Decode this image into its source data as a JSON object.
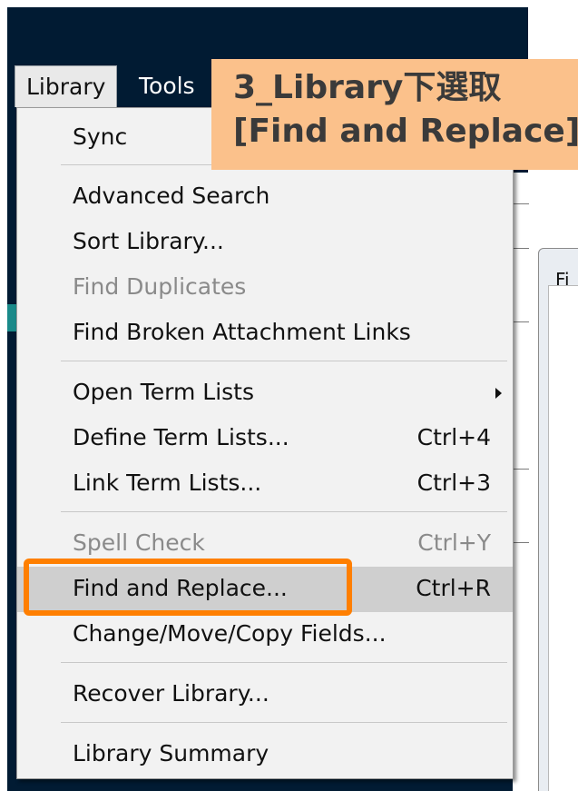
{
  "menubar": {
    "library": "Library",
    "tools": "Tools"
  },
  "annotation": {
    "line1": "3_Library下選取",
    "line2": "[Find and Replace]"
  },
  "background_window": {
    "title_fragment": "Fi"
  },
  "menu": {
    "items": [
      {
        "label": "Sync",
        "shortcut": ""
      },
      {
        "label": "Advanced Search",
        "shortcut": ""
      },
      {
        "label": "Sort Library...",
        "shortcut": ""
      },
      {
        "label": "Find Duplicates",
        "shortcut": ""
      },
      {
        "label": "Find Broken Attachment Links",
        "shortcut": ""
      },
      {
        "label": "Open Term Lists",
        "shortcut": ""
      },
      {
        "label": "Define Term Lists...",
        "shortcut": "Ctrl+4"
      },
      {
        "label": "Link Term Lists...",
        "shortcut": "Ctrl+3"
      },
      {
        "label": "Spell Check",
        "shortcut": "Ctrl+Y"
      },
      {
        "label": "Find and Replace...",
        "shortcut": "Ctrl+R"
      },
      {
        "label": "Change/Move/Copy Fields...",
        "shortcut": ""
      },
      {
        "label": "Recover Library...",
        "shortcut": ""
      },
      {
        "label": "Library Summary",
        "shortcut": ""
      }
    ]
  },
  "colors": {
    "highlight_border": "#ff7f00",
    "annotation_bg": "#fbc18b",
    "app_bg": "#011b33"
  }
}
